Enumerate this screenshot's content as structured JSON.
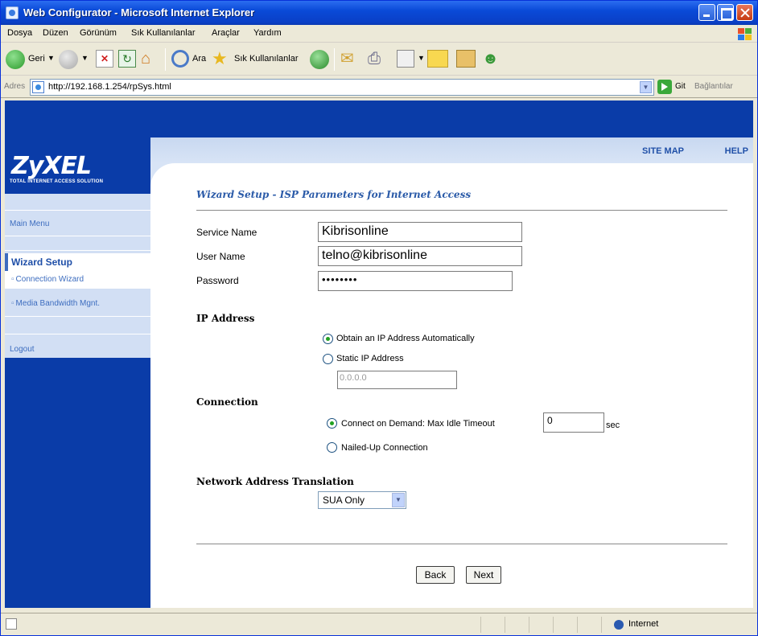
{
  "window": {
    "title": "Web Configurator - Microsoft Internet Explorer"
  },
  "menu": [
    "Dosya",
    "Düzen",
    "Görünüm",
    "Sık Kullanılanlar",
    "Araçlar",
    "Yardım"
  ],
  "toolbar": {
    "back_label": "Geri",
    "search_label": "Ara",
    "favorites_label": "Sık Kullanılanlar"
  },
  "address": {
    "label": "Adres",
    "url": "http://192.168.1.254/rpSys.html",
    "go_label": "Git",
    "links_label": "Bağlantılar"
  },
  "brand": {
    "logo": "ZyXEL",
    "tagline": "TOTAL INTERNET ACCESS SOLUTION"
  },
  "header": {
    "site_map": "SITE MAP",
    "help": "HELP"
  },
  "sidebar": {
    "main_menu": "Main Menu",
    "wizard_setup": "Wizard Setup",
    "connection_wizard": "Connection Wizard",
    "media_bandwidth": "Media Bandwidth Mgnt.",
    "logout": "Logout"
  },
  "form": {
    "title": "Wizard Setup - ISP Parameters for Internet Access",
    "service_name_label": "Service Name",
    "service_name": "Kibrisonline",
    "user_name_label": "User Name",
    "user_name": "telno@kibrisonline",
    "password_label": "Password",
    "password": "••••••••",
    "ip_section": "IP Address",
    "ip_auto": "Obtain an IP Address Automatically",
    "ip_static": "Static IP Address",
    "static_ip": "0.0.0.0",
    "connection_section": "Connection",
    "connect_on_demand": "Connect on Demand: Max Idle Timeout",
    "idle_timeout": "0",
    "sec": "sec",
    "nailed_up": "Nailed-Up Connection",
    "nat_section": "Network Address Translation",
    "nat_value": "SUA Only",
    "back": "Back",
    "next": "Next"
  },
  "status": {
    "zone": "Internet"
  }
}
